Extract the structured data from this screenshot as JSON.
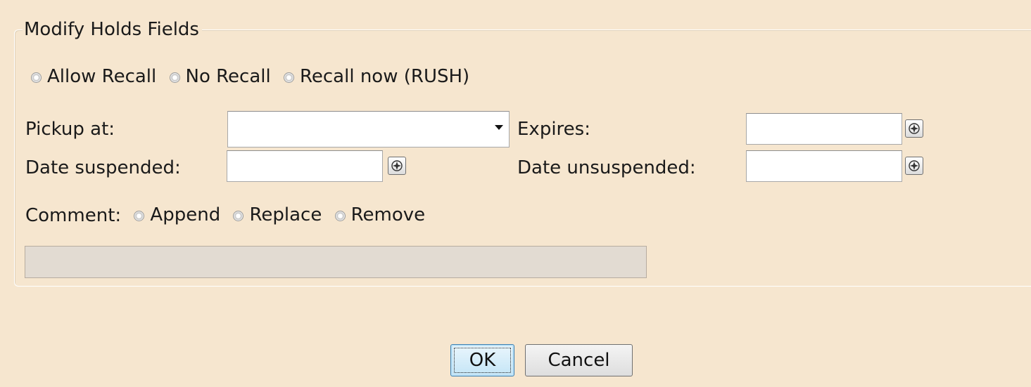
{
  "fieldset": {
    "legend": "Modify Holds Fields"
  },
  "recall_options": [
    {
      "label": "Allow Recall",
      "selected": false
    },
    {
      "label": "No Recall",
      "selected": false
    },
    {
      "label": "Recall now (RUSH)",
      "selected": false
    }
  ],
  "pickup": {
    "label": "Pickup at:",
    "value": ""
  },
  "expires": {
    "label": "Expires:",
    "value": ""
  },
  "date_suspended": {
    "label": "Date suspended:",
    "value": ""
  },
  "date_unsuspended": {
    "label": "Date unsuspended:",
    "value": ""
  },
  "comment": {
    "label": "Comment:",
    "options": [
      {
        "label": "Append",
        "selected": false
      },
      {
        "label": "Replace",
        "selected": false
      },
      {
        "label": "Remove",
        "selected": false
      }
    ],
    "value": ""
  },
  "buttons": {
    "ok": "OK",
    "cancel": "Cancel"
  },
  "icons": {
    "calendar_button": "calendar-icon",
    "dropdown": "chevron-down-icon"
  }
}
